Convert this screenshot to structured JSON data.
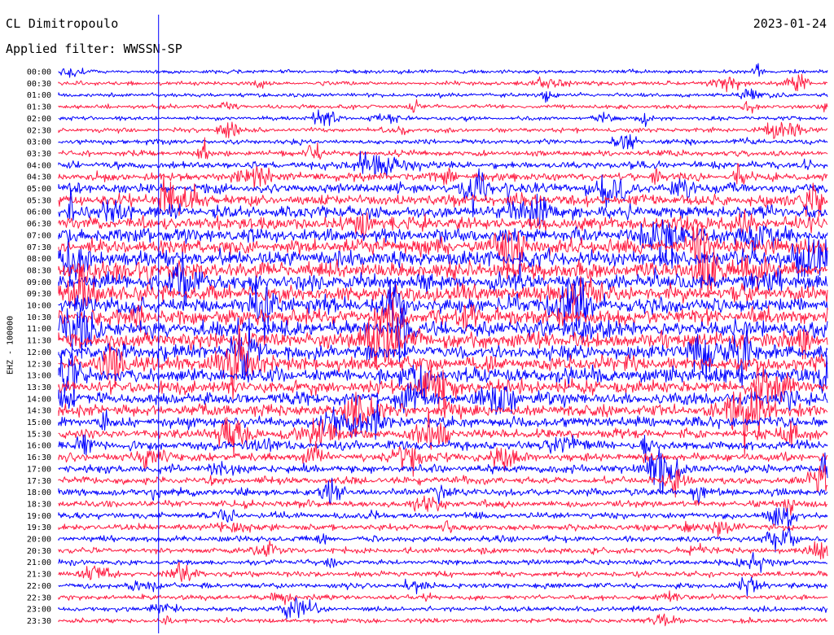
{
  "header": {
    "station": "CL Dimitropoulo",
    "date": "2023-01-24",
    "filter_label": "Applied filter: WWSSN-SP",
    "channel_label": "EHZ - 100000"
  },
  "colors": {
    "trace_a": "#0000ff",
    "trace_b": "#ff1a40",
    "background": "#ffffff",
    "text": "#000000"
  },
  "chart_data": {
    "type": "line",
    "title": "",
    "xlabel": "",
    "ylabel": "EHZ - 100000",
    "rows": [
      "00:00",
      "00:30",
      "01:00",
      "01:30",
      "02:00",
      "02:30",
      "03:00",
      "03:30",
      "04:00",
      "04:30",
      "05:00",
      "05:30",
      "06:00",
      "06:30",
      "07:00",
      "07:30",
      "08:00",
      "08:30",
      "09:00",
      "09:30",
      "10:00",
      "10:30",
      "11:00",
      "11:30",
      "12:00",
      "12:30",
      "13:00",
      "13:30",
      "14:00",
      "14:30",
      "15:00",
      "15:30",
      "16:00",
      "16:30",
      "17:00",
      "17:30",
      "18:00",
      "18:30",
      "19:00",
      "19:30",
      "20:00",
      "20:30",
      "21:00",
      "21:30",
      "22:00",
      "22:30",
      "23:00",
      "23:30"
    ],
    "row_colors": [
      "#0000ff",
      "#ff1a40"
    ],
    "minutes_per_row": 30,
    "time_marker_minute": 3.9,
    "time_marker_row": "00:00",
    "relative_noise": [
      1.0,
      1.0,
      1.0,
      1.0,
      1.0,
      1.1,
      1.2,
      1.4,
      1.7,
      2.0,
      2.3,
      2.7,
      3.0,
      3.3,
      3.5,
      3.7,
      3.8,
      3.9,
      3.9,
      3.9,
      3.9,
      3.9,
      3.9,
      3.8,
      3.8,
      3.6,
      3.5,
      3.2,
      3.0,
      2.8,
      2.6,
      2.4,
      2.2,
      2.0,
      1.9,
      1.8,
      1.7,
      1.6,
      1.5,
      1.5,
      1.4,
      1.4,
      1.3,
      1.3,
      1.3,
      1.2,
      1.2,
      1.2
    ]
  }
}
